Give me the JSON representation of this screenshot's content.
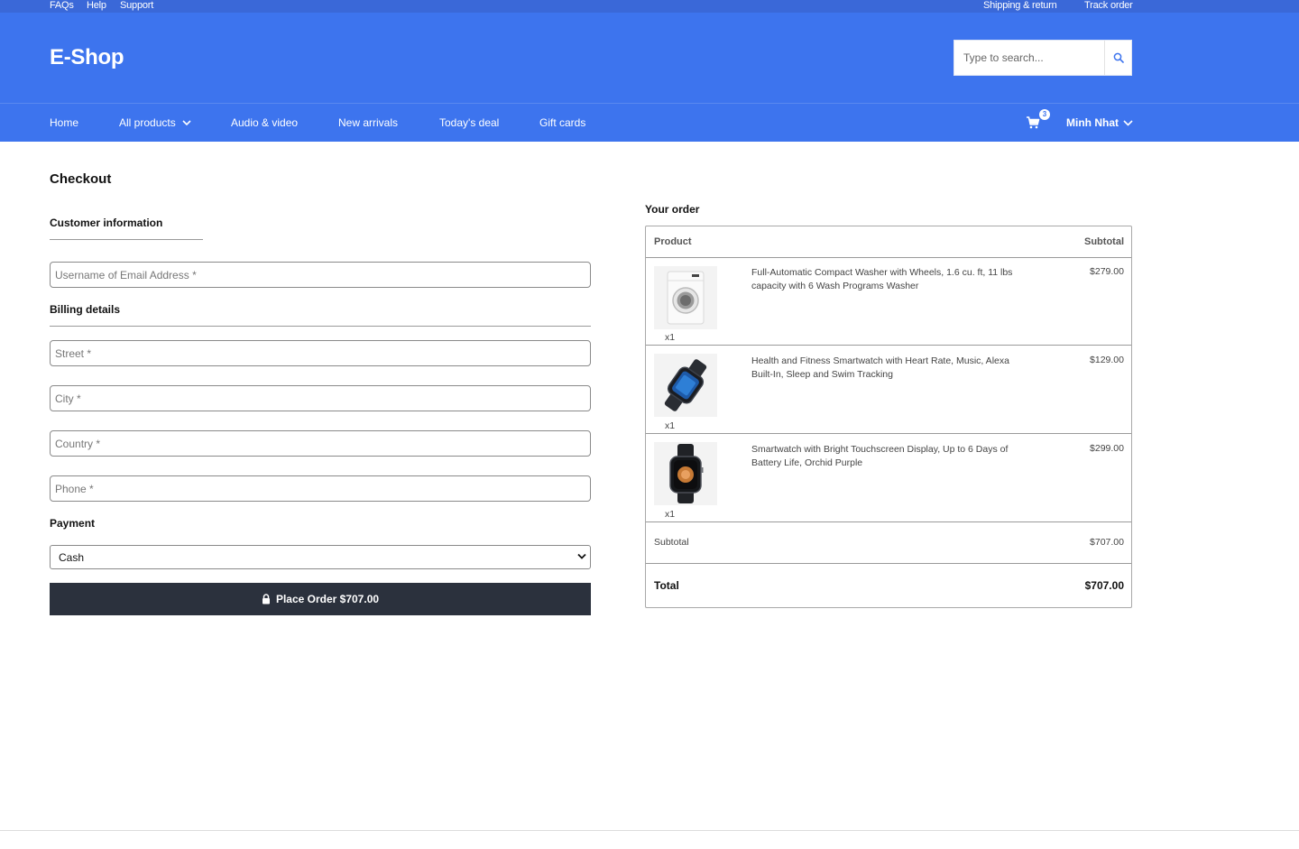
{
  "topbar": {
    "left_links": [
      "FAQs",
      "Help",
      "Support"
    ],
    "right_links": [
      "Shipping & return",
      "Track order"
    ]
  },
  "header": {
    "logo": "E-Shop",
    "search_placeholder": "Type to search..."
  },
  "nav": {
    "items": [
      "Home",
      "All products",
      "Audio & video",
      "New arrivals",
      "Today's deal",
      "Gift cards"
    ],
    "cart_count": "3",
    "user": "Minh Nhat"
  },
  "checkout": {
    "title": "Checkout",
    "customer_info_title": "Customer information",
    "username_placeholder": "Username of Email Address *",
    "billing_title": "Billing details",
    "street_placeholder": "Street *",
    "city_placeholder": "City *",
    "country_placeholder": "Country *",
    "phone_placeholder": "Phone *",
    "payment_title": "Payment",
    "payment_selected": "Cash",
    "place_order_label": "Place Order $707.00"
  },
  "order": {
    "title": "Your order",
    "col_product": "Product",
    "col_subtotal": "Subtotal",
    "items": [
      {
        "name": "Full-Automatic Compact Washer with Wheels, 1.6 cu. ft, 11 lbs capacity with 6 Wash Programs Washer",
        "price": "$279.00",
        "qty": "x1",
        "icon": "washer-image"
      },
      {
        "name": "Health and Fitness Smartwatch with Heart Rate, Music, Alexa Built-In, Sleep and Swim Tracking",
        "price": "$129.00",
        "qty": "x1",
        "icon": "smartwatch-image"
      },
      {
        "name": "Smartwatch with Bright Touchscreen Display, Up to 6 Days of Battery Life, Orchid Purple",
        "price": "$299.00",
        "qty": "x1",
        "icon": "smartwatch-image"
      }
    ],
    "subtotal_label": "Subtotal",
    "subtotal_value": "$707.00",
    "total_label": "Total",
    "total_value": "$707.00"
  },
  "colors": {
    "topbar": "#3a68d8",
    "header": "#3d74ee",
    "button_dark": "#2b313d"
  }
}
